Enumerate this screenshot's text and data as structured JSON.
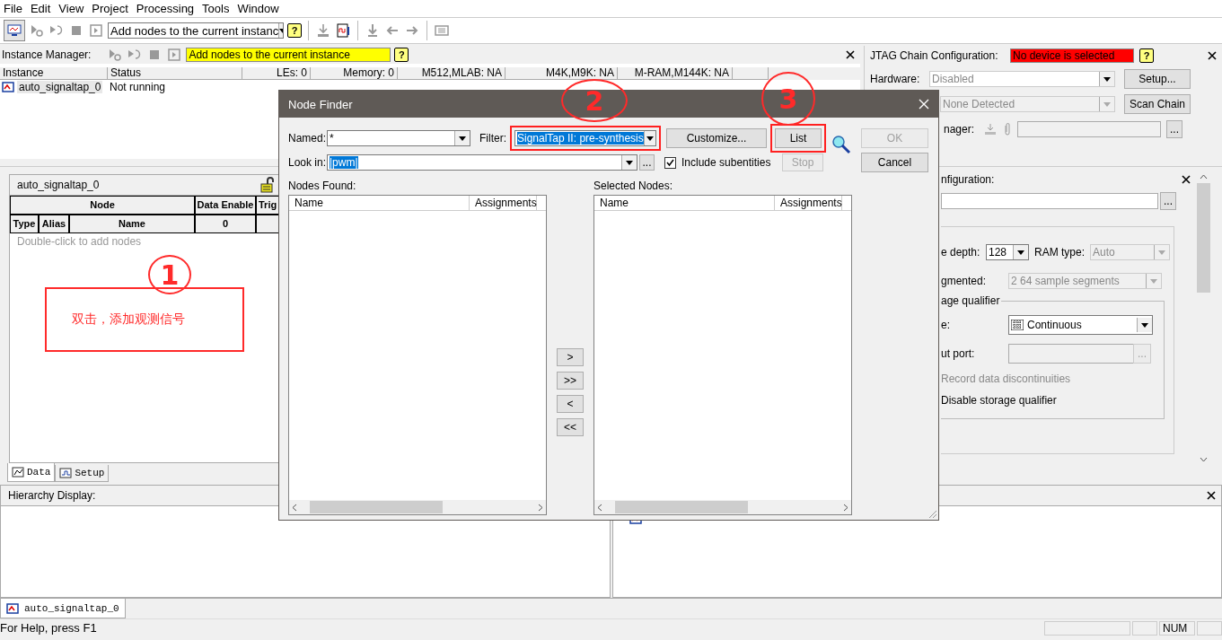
{
  "menu": [
    {
      "label": "File"
    },
    {
      "label": "Edit"
    },
    {
      "label": "View"
    },
    {
      "label": "Project"
    },
    {
      "label": "Processing"
    },
    {
      "label": "Tools"
    },
    {
      "label": "Window"
    }
  ],
  "toolbar": {
    "combo": "Add nodes to the current instanc",
    "help": "?"
  },
  "instance_manager": {
    "label": "Instance Manager:",
    "field": "Add nodes to the current instance",
    "help": "?",
    "columns": [
      "Instance",
      "Status",
      "LEs: 0",
      "Memory: 0",
      "M512,MLAB: NA",
      "M4K,M9K: NA",
      "M-RAM,M144K: NA"
    ],
    "rows": [
      {
        "instance": "auto_signaltap_0",
        "status": "Not running",
        "selected": true
      }
    ]
  },
  "jtag": {
    "title": "JTAG Chain Configuration:",
    "device_status": "No device is selected",
    "help": "?",
    "hardware_label": "Hardware:",
    "hardware": "Disabled",
    "setup_button": "Setup...",
    "device": "None Detected",
    "scan_button": "Scan Chain",
    "sof_label": "nager:",
    "browse_button": "..."
  },
  "node_list": {
    "instance": "auto_signaltap_0",
    "group_header": "Node",
    "columns": [
      "Type",
      "Alias",
      "Name"
    ],
    "data_enable_header": "Data Enable",
    "data_enable_count": "0",
    "trigger_header": "Trig",
    "hint": "Double-click to add nodes"
  },
  "signal_config": {
    "title": "nfiguration:",
    "browse_button": "...",
    "depth_label": "e depth:",
    "depth": "128",
    "ram_label": "RAM type:",
    "ram": "Auto",
    "segmented_label": "gmented:",
    "segments": "2  64 sample segments",
    "qualifier_group": "age qualifier",
    "type_label": "e:",
    "type": "Continuous",
    "port_label": "ut port:",
    "port_button": "...",
    "options": [
      {
        "label": "Record data discontinuities",
        "disabled": true
      },
      {
        "label": "Disable storage qualifier",
        "disabled": false
      }
    ]
  },
  "view_tabs": [
    {
      "label": "Data",
      "selected": true
    },
    {
      "label": "Setup",
      "selected": false
    }
  ],
  "hierarchy": {
    "title": "Hierarchy Display:"
  },
  "document_tabs": [
    {
      "label": "auto_signaltap_0",
      "selected": true
    }
  ],
  "status_bar": {
    "help": "For Help, press F1",
    "num": "NUM"
  },
  "dialog": {
    "title": "Node Finder",
    "named_label": "Named:",
    "named": "*",
    "filter_label": "Filter:",
    "filter": "SignalTap II: pre-synthesis",
    "filter_highlighted": true,
    "customize_button": "Customize...",
    "list_button": "List",
    "list_highlighted": true,
    "ok_button": {
      "label": "OK",
      "disabled": true
    },
    "cancel_button": {
      "label": "Cancel",
      "disabled": false
    },
    "look_in_label": "Look in:",
    "look_in": "|pwm|",
    "browse_button": "...",
    "include_subentities": {
      "label": "Include subentities",
      "checked": true
    },
    "stop_button": {
      "label": "Stop",
      "disabled": true
    },
    "found": {
      "title": "Nodes Found:",
      "columns": [
        "Name",
        "Assignments"
      ]
    },
    "selected": {
      "title": "Selected Nodes:",
      "columns": [
        "Name",
        "Assignments"
      ]
    },
    "move_buttons": [
      ">",
      ">>",
      "<",
      "<<"
    ]
  },
  "annotations": {
    "marks": [
      {
        "label": "1"
      },
      {
        "label": "2"
      },
      {
        "label": "3"
      }
    ],
    "note": "双击，添加观测信号"
  }
}
